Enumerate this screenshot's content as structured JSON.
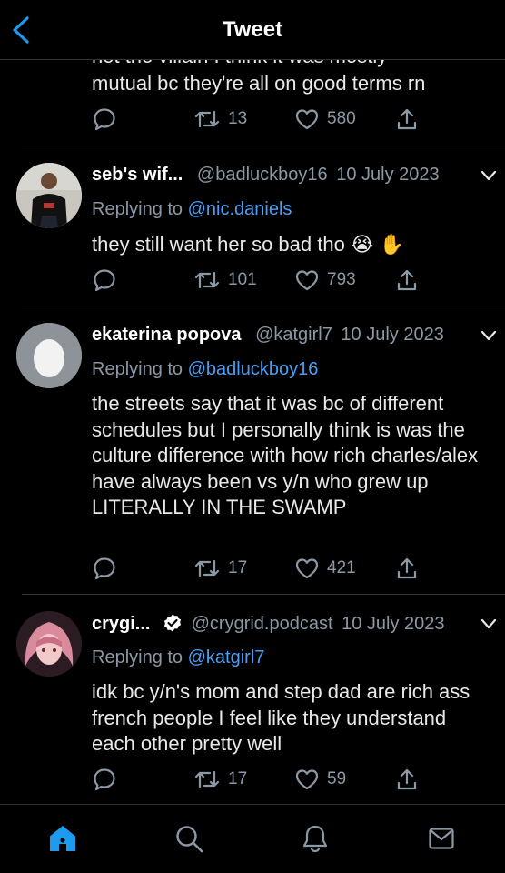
{
  "header": {
    "title": "Tweet"
  },
  "first_tweet": {
    "clipped_text": "not the villain I think it was mostly",
    "text_line2": "mutual bc they're all on good terms rn",
    "retweets": "13",
    "likes": "580"
  },
  "tweets": [
    {
      "name": "seb's wif...",
      "handle": "@badluckboy16",
      "date": "10 July 2023",
      "replying_prefix": "Replying to ",
      "replying_to": "@nic.daniels",
      "text": "they still want her so bad tho 😭 ✋",
      "retweets": "101",
      "likes": "793"
    },
    {
      "name": "ekaterina popova",
      "handle": "@katgirl7",
      "date": "10 July 2023",
      "replying_prefix": "Replying to ",
      "replying_to": "@badluckboy16",
      "text": "the streets say that it was bc of different schedules but I personally think is was the culture difference with how rich charles/alex have always been vs y/n who grew up LITERALLY IN THE SWAMP",
      "retweets": "17",
      "likes": "421"
    },
    {
      "name": "crygi...",
      "handle": "@crygrid.podcast",
      "date": "10 July 2023",
      "replying_prefix": "Replying to ",
      "replying_to": "@katgirl7",
      "text": "idk bc y/n's mom and step dad are rich ass french people I feel like they understand each other pretty well",
      "retweets": "17",
      "likes": "59"
    }
  ],
  "icons": {
    "back": "chevron-left-icon",
    "reply": "speech-bubble-icon",
    "retweet": "retweet-icon",
    "like": "heart-icon",
    "share": "share-icon",
    "more": "chevron-down-icon",
    "verified": "verified-badge-icon",
    "home": "home-icon",
    "search": "search-icon",
    "notifications": "bell-icon",
    "messages": "envelope-icon"
  },
  "colors": {
    "background": "#000000",
    "text": "#e7e9ea",
    "secondary": "#8b98a5",
    "accent": "#1d9bf0",
    "mention": "#4a9ff5"
  }
}
